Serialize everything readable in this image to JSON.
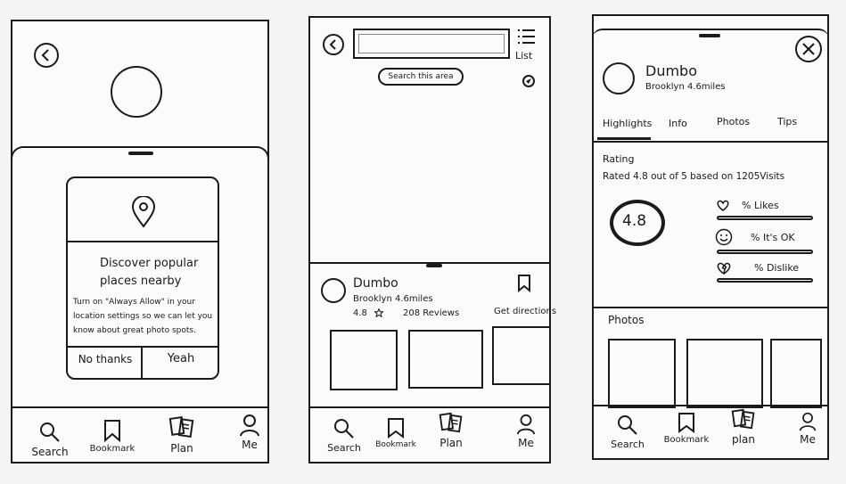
{
  "nav": {
    "search": "Search",
    "bookmark": "Bookmark",
    "plan": "Plan",
    "plan_alt": "plan",
    "me": "Me"
  },
  "screen1": {
    "dialog": {
      "title_line1": "Discover popular",
      "title_line2": "places nearby",
      "body_line1": "Turn on \"Always Allow\" in your",
      "body_line2": "location settings so we can let you",
      "body_line3": "know about great photo spots.",
      "no_thanks": "No thanks",
      "yeah": "Yeah"
    }
  },
  "screen2": {
    "search_area_button": "Search this area",
    "list_label": "List",
    "place": {
      "name": "Dumbo",
      "location": "Brooklyn 4.6miles",
      "rating": "4.8",
      "reviews": "208 Reviews",
      "directions": "Get directions"
    }
  },
  "screen3": {
    "place": {
      "name": "Dumbo",
      "location": "Brooklyn 4.6miles"
    },
    "tabs": [
      "Highlights",
      "Info",
      "Photos",
      "Tips"
    ],
    "rating_heading": "Rating",
    "rating_summary": "Rated 4.8 out of 5 based on 1205Visits",
    "rating_value": "4.8",
    "likes_label": "% Likes",
    "ok_label": "% It's OK",
    "dislike_label": "% Dislike",
    "photos_heading": "Photos"
  }
}
